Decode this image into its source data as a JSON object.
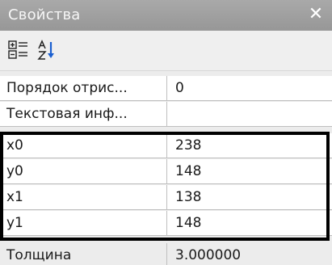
{
  "window": {
    "title": "Свойства",
    "close_glyph": "✕"
  },
  "toolbar": {
    "buttons": [
      {
        "name": "categorized-view-button",
        "icon": "categorized-icon"
      },
      {
        "name": "alphabetical-sort-button",
        "icon": "sort-az-icon"
      }
    ]
  },
  "properties": [
    {
      "name": "Порядок отрис...",
      "value": "0"
    },
    {
      "name": "Текстовая инф...",
      "value": ""
    },
    {
      "name": "x0",
      "value": "238"
    },
    {
      "name": "y0",
      "value": "148"
    },
    {
      "name": "x1",
      "value": "138"
    },
    {
      "name": "y1",
      "value": "148"
    },
    {
      "name": "Толщина",
      "value": "3.000000"
    }
  ],
  "colors": {
    "titlebar": "#a0a0a0",
    "highlight_border": "#000000",
    "sort_arrow": "#1a5fd0"
  }
}
